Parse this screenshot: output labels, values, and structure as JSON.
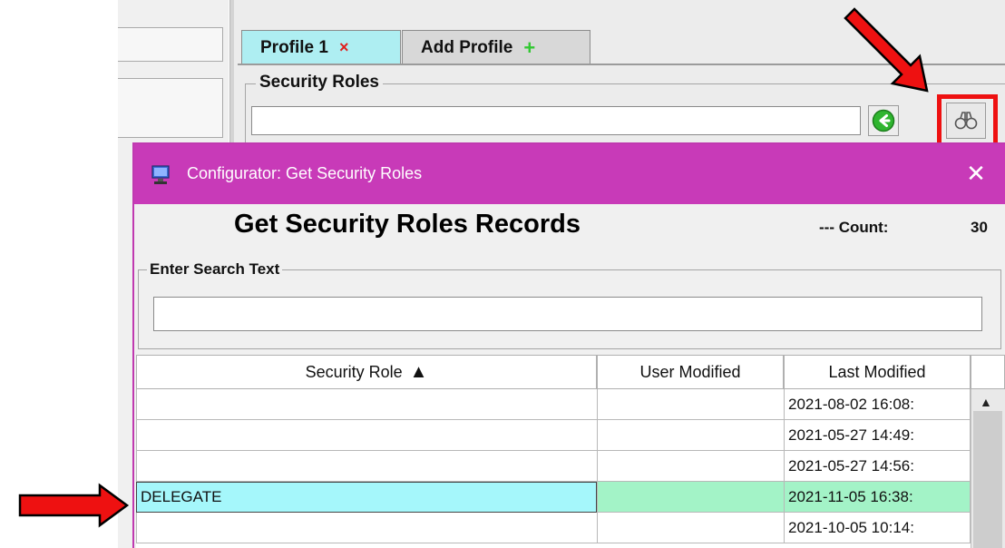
{
  "background_app": {
    "tabs": [
      {
        "label": "Profile 1",
        "close_glyph": "×"
      },
      {
        "label": "Add Profile",
        "add_glyph": "+"
      }
    ],
    "security_roles_group": {
      "label": "Security Roles",
      "value": ""
    }
  },
  "dialog": {
    "title": "Configurator: Get Security Roles",
    "close_glyph": "✕",
    "heading": "Get Security Roles Records",
    "count_label": "---  Count:",
    "count_value": "30",
    "search": {
      "label": "Enter Search Text",
      "value": ""
    },
    "table": {
      "columns": [
        "Security Role",
        "User Modified",
        "Last Modified"
      ],
      "sort_glyph": "▲",
      "rows": [
        {
          "role": "",
          "user_modified": "",
          "last_modified": "2021-08-02 16:08:",
          "selected": false
        },
        {
          "role": "",
          "user_modified": "",
          "last_modified": "2021-05-27 14:49:",
          "selected": false
        },
        {
          "role": "",
          "user_modified": "",
          "last_modified": "2021-05-27 14:56:",
          "selected": false
        },
        {
          "role": "DELEGATE",
          "user_modified": "",
          "last_modified": "2021-11-05 16:38:",
          "selected": true
        },
        {
          "role": "",
          "user_modified": "",
          "last_modified": "2021-10-05 10:14:",
          "selected": false
        }
      ]
    }
  },
  "icons": {
    "go": "green-circle-arrow-left-icon",
    "lookup": "binoculars-icon",
    "app": "computer-icon",
    "annotation_arrows": "red-arrow-icon"
  },
  "colors": {
    "titlebar": "#c83ab8",
    "active_tab": "#aeeef2",
    "selected_row": "#a5f7fb",
    "selected_row_alt": "#a3f3c7",
    "annotation": "#ee1111"
  }
}
